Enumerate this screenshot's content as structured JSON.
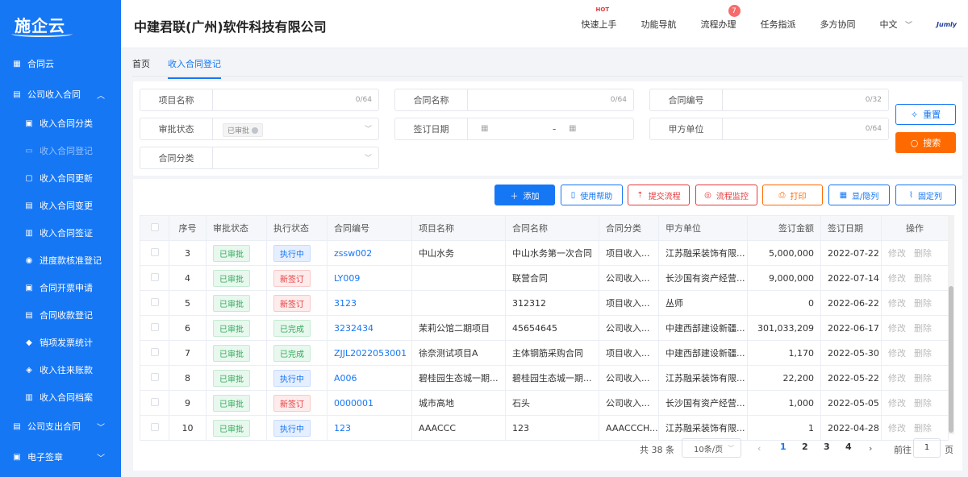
{
  "app": {
    "logo": "施企云",
    "company": "中建君联(广州)软件科技有限公司"
  },
  "topnav": {
    "quick_start": "快速上手",
    "hot": "HOT",
    "func_nav": "功能导航",
    "process": "流程办理",
    "process_badge": "7",
    "task": "任务指派",
    "collab": "多方协同",
    "lang": "中文",
    "brand": "Jumly"
  },
  "sidebar": {
    "items": [
      {
        "label": "合同云",
        "level": "top",
        "icon": "grid-icon"
      },
      {
        "label": "公司收入合同",
        "level": "top",
        "icon": "document-icon",
        "expanded": true
      },
      {
        "label": "收入合同分类",
        "level": "sub",
        "icon": "category-icon"
      },
      {
        "label": "收入合同登记",
        "level": "sub",
        "icon": "register-icon",
        "active": true
      },
      {
        "label": "收入合同更新",
        "level": "sub",
        "icon": "update-icon"
      },
      {
        "label": "收入合同变更",
        "level": "sub",
        "icon": "change-icon"
      },
      {
        "label": "收入合同签证",
        "level": "sub",
        "icon": "visa-icon"
      },
      {
        "label": "进度款核准登记",
        "level": "sub",
        "icon": "progress-icon"
      },
      {
        "label": "合同开票申请",
        "level": "sub",
        "icon": "invoice-icon"
      },
      {
        "label": "合同收款登记",
        "level": "sub",
        "icon": "payment-icon"
      },
      {
        "label": "销项发票统计",
        "level": "sub",
        "icon": "stats-icon"
      },
      {
        "label": "收入往来账款",
        "level": "sub",
        "icon": "account-icon"
      },
      {
        "label": "收入合同档案",
        "level": "sub",
        "icon": "archive-icon"
      },
      {
        "label": "公司支出合同",
        "level": "top",
        "icon": "document-icon"
      },
      {
        "label": "电子签章",
        "level": "top",
        "icon": "seal-icon"
      }
    ]
  },
  "tabs": {
    "home": "首页",
    "current": "收入合同登记"
  },
  "search": {
    "project_name": {
      "label": "项目名称",
      "count": "0/64"
    },
    "contract_name": {
      "label": "合同名称",
      "count": "0/64"
    },
    "contract_no": {
      "label": "合同编号",
      "count": "0/32"
    },
    "approval": {
      "label": "审批状态",
      "tag": "已审批"
    },
    "sign_date": {
      "label": "签订日期",
      "sep": "-"
    },
    "party_a": {
      "label": "甲方单位",
      "count": "0/64"
    },
    "category": {
      "label": "合同分类"
    },
    "reset": "重置",
    "search": "搜索"
  },
  "toolbar": {
    "add": "添加",
    "help": "使用帮助",
    "submit": "提交流程",
    "monitor": "流程监控",
    "print": "打印",
    "columns": "显/隐列",
    "fixed": "固定列"
  },
  "table": {
    "headers": [
      "序号",
      "审批状态",
      "执行状态",
      "合同编号",
      "项目名称",
      "合同名称",
      "合同分类",
      "甲方单位",
      "签订金额",
      "签订日期",
      "操作"
    ],
    "edit": "修改",
    "delete": "删除",
    "rows": [
      {
        "no": "3",
        "approval": "已审批",
        "exec": "执行中",
        "exec_color": "blue",
        "code": "zssw002",
        "project": "中山水务",
        "name": "中山水务第一次合同",
        "cat": "项目收入...",
        "party": "江苏融采装饰有限...",
        "amount": "5,000,000",
        "date": "2022-07-22"
      },
      {
        "no": "4",
        "approval": "已审批",
        "exec": "新签订",
        "exec_color": "red",
        "code": "LY009",
        "project": "",
        "name": "联营合同",
        "cat": "公司收入...",
        "party": "长沙国有资产经营...",
        "amount": "9,000,000",
        "date": "2022-07-14"
      },
      {
        "no": "5",
        "approval": "已审批",
        "exec": "新签订",
        "exec_color": "red",
        "code": "3123",
        "project": "",
        "name": "312312",
        "cat": "项目收入...",
        "party": "丛师",
        "amount": "0",
        "date": "2022-06-22"
      },
      {
        "no": "6",
        "approval": "已审批",
        "exec": "已完成",
        "exec_color": "green",
        "code": "3232434",
        "project": "茉莉公馆二期项目",
        "name": "45654645",
        "cat": "公司收入...",
        "party": "中建西部建设新疆...",
        "amount": "301,033,209",
        "date": "2022-06-17"
      },
      {
        "no": "7",
        "approval": "已审批",
        "exec": "已完成",
        "exec_color": "green",
        "code": "ZJJL2022053001",
        "project": "徐奈测试项目A",
        "name": "主体钢筋采购合同",
        "cat": "项目收入...",
        "party": "中建西部建设新疆...",
        "amount": "1,170",
        "date": "2022-05-30"
      },
      {
        "no": "8",
        "approval": "已审批",
        "exec": "执行中",
        "exec_color": "blue",
        "code": "A006",
        "project": "碧桂园生态城一期...",
        "name": "碧桂园生态城一期...",
        "cat": "公司收入...",
        "party": "江苏融采装饰有限...",
        "amount": "22,200",
        "date": "2022-05-22"
      },
      {
        "no": "9",
        "approval": "已审批",
        "exec": "新签订",
        "exec_color": "red",
        "code": "0000001",
        "project": "城市高地",
        "name": "石头",
        "cat": "公司收入...",
        "party": "长沙国有资产经营...",
        "amount": "1,000",
        "date": "2022-05-05"
      },
      {
        "no": "10",
        "approval": "已审批",
        "exec": "执行中",
        "exec_color": "blue",
        "code": "123",
        "project": "AAACCC",
        "name": "123",
        "cat": "AAACCCH...",
        "party": "江苏融采装饰有限...",
        "amount": "1",
        "date": "2022-04-28"
      }
    ]
  },
  "pager": {
    "total": "共 38 条",
    "size": "10条/页",
    "pages": [
      "1",
      "2",
      "3",
      "4"
    ],
    "current": "1",
    "goto": "前往",
    "goto_val": "1",
    "page_unit": "页"
  }
}
